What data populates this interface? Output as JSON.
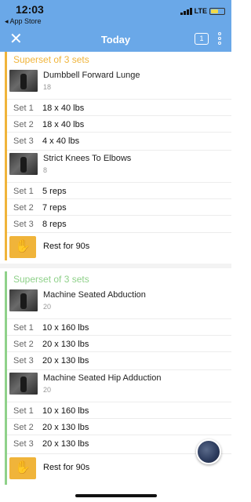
{
  "status": {
    "time": "12:03",
    "back": "◂ App Store",
    "carrier": "LTE"
  },
  "nav": {
    "title": "Today",
    "close_icon": "close-icon",
    "comment_badge": "1",
    "more_icon": "more-vertical-icon"
  },
  "colors": {
    "header_blue": "#6aa8e8",
    "orange": "#f0b43a",
    "green": "#8fd18a"
  },
  "groups": [
    {
      "title": "Superset of 3 sets",
      "exercises": [
        {
          "name": "Dumbbell Forward Lunge",
          "sub": "18",
          "sets": [
            {
              "label": "Set 1",
              "value": "18 x 40 lbs"
            },
            {
              "label": "Set 2",
              "value": "18 x 40 lbs"
            },
            {
              "label": "Set 3",
              "value": "4 x 40 lbs"
            }
          ]
        },
        {
          "name": "Strict Knees To Elbows",
          "sub": "8",
          "sets": [
            {
              "label": "Set 1",
              "value": "5 reps"
            },
            {
              "label": "Set 2",
              "value": "7 reps"
            },
            {
              "label": "Set 3",
              "value": "8 reps"
            }
          ]
        }
      ],
      "rest": "Rest for 90s"
    },
    {
      "title": "Superset of 3 sets",
      "exercises": [
        {
          "name": "Machine Seated Abduction",
          "sub": "20",
          "sets": [
            {
              "label": "Set 1",
              "value": "10 x 160 lbs"
            },
            {
              "label": "Set 2",
              "value": "20 x 130 lbs"
            },
            {
              "label": "Set 3",
              "value": "20 x 130 lbs"
            }
          ]
        },
        {
          "name": "Machine Seated Hip Adduction",
          "sub": "20",
          "sets": [
            {
              "label": "Set 1",
              "value": "10 x 160 lbs"
            },
            {
              "label": "Set 2",
              "value": "20 x 130 lbs"
            },
            {
              "label": "Set 3",
              "value": "20 x 130 lbs"
            }
          ]
        }
      ],
      "rest": "Rest for 90s"
    }
  ]
}
